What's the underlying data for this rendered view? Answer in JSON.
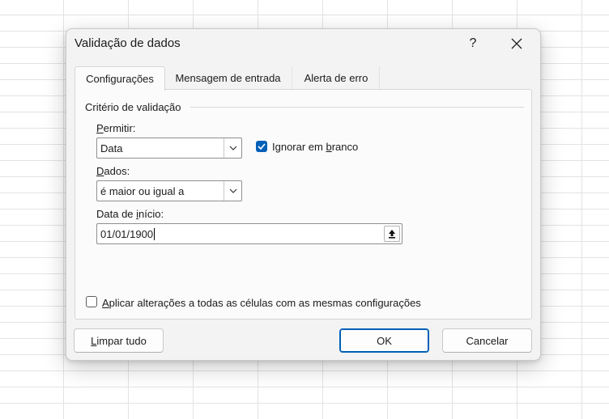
{
  "dialog": {
    "title": "Validação de dados",
    "help_label": "?",
    "tabs": [
      "Configurações",
      "Mensagem de entrada",
      "Alerta de erro"
    ]
  },
  "settings": {
    "group_label": "Critério de validação",
    "allow_label": {
      "prefix": "",
      "accel": "P",
      "suffix": "ermitir:"
    },
    "allow_value": "Data",
    "ignore_blank": {
      "prefix": "Ignorar em ",
      "accel": "b",
      "suffix": "ranco",
      "checked": true
    },
    "data_label": {
      "prefix": "",
      "accel": "D",
      "suffix": "ados:"
    },
    "data_value": "é maior ou igual a",
    "start_label": {
      "prefix": "Data de ",
      "accel": "i",
      "suffix": "nício:"
    },
    "start_value": "01/01/1900",
    "apply_all": {
      "prefix": "",
      "accel": "A",
      "suffix": "plicar alterações a todas as células com as mesmas configurações",
      "checked": false
    }
  },
  "buttons": {
    "clear_all": {
      "prefix": "",
      "accel": "L",
      "suffix": "impar tudo"
    },
    "ok": "OK",
    "cancel": "Cancelar"
  },
  "icons": {
    "close": "close-icon",
    "dropdown": "chevron-down-icon",
    "collapse": "collapse-dialog-icon",
    "check": "checkmark-icon"
  },
  "colors": {
    "accent": "#005fb8",
    "dialog_bg": "#f3f3f3",
    "panel_bg": "#fbfbfb"
  }
}
